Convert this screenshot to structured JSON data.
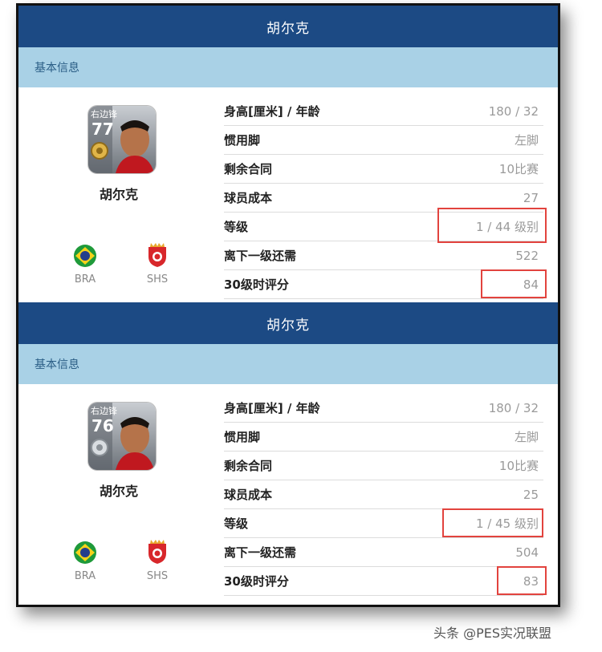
{
  "cards": [
    {
      "title": "胡尔克",
      "section": "基本信息",
      "player": {
        "position": "右边锋",
        "rating": "77",
        "name": "胡尔克",
        "nation": "BRA",
        "club": "SHS"
      },
      "rows": [
        {
          "label": "身高[厘米] / 年龄",
          "value": "180 / 32"
        },
        {
          "label": "惯用脚",
          "value": "左脚"
        },
        {
          "label": "剩余合同",
          "value": "10比赛"
        },
        {
          "label": "球员成本",
          "value": "27"
        },
        {
          "label": "等级",
          "value": "1 / 44 级别"
        },
        {
          "label": "离下一级还需",
          "value": "522"
        },
        {
          "label": "30级时评分",
          "value": "84"
        }
      ]
    },
    {
      "title": "胡尔克",
      "section": "基本信息",
      "player": {
        "position": "右边锋",
        "rating": "76",
        "name": "胡尔克",
        "nation": "BRA",
        "club": "SHS"
      },
      "rows": [
        {
          "label": "身高[厘米] / 年龄",
          "value": "180 / 32"
        },
        {
          "label": "惯用脚",
          "value": "左脚"
        },
        {
          "label": "剩余合同",
          "value": "10比赛"
        },
        {
          "label": "球员成本",
          "value": "25"
        },
        {
          "label": "等级",
          "value": "1 / 45 级别"
        },
        {
          "label": "离下一级还需",
          "value": "504"
        },
        {
          "label": "30级时评分",
          "value": "83"
        }
      ]
    }
  ],
  "watermark": "头条 @PES实况联盟",
  "colors": {
    "title_bar": "#1c4a84",
    "section_bar": "#a9d1e6",
    "highlight": "#e2433e"
  }
}
